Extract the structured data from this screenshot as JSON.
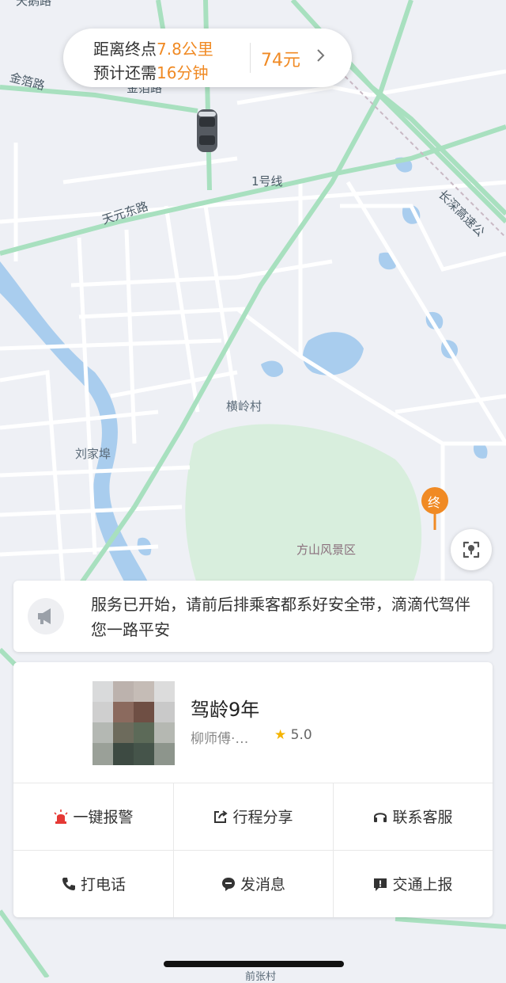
{
  "trip": {
    "distance_prefix": "距离终点",
    "distance_value": "7.8公里",
    "time_prefix": "预计还需",
    "time_value": "16分钟",
    "price": "74元"
  },
  "map": {
    "labels": {
      "top_left": "天鹅路",
      "jinju_road": "金箔路",
      "jinju_road_2": "金箔路",
      "line1": "1号线",
      "tianyuan_road": "天元东路",
      "changshen": "长深高速公",
      "henglingcun": "横岭村",
      "liujiahan": "刘家埠",
      "fangshan": "方山风景区",
      "bottom": "前张村"
    },
    "end_marker": "终"
  },
  "notice": {
    "text": "服务已开始，请前后排乘客都系好安全带，滴滴代驾伴您一路平安"
  },
  "driver": {
    "experience": "驾龄9年",
    "name": "柳师傅·…",
    "rating": "5.0"
  },
  "actions": {
    "alarm": "一键报警",
    "share": "行程分享",
    "service": "联系客服",
    "call": "打电话",
    "message": "发消息",
    "report": "交通上报"
  },
  "colors": {
    "accent": "#f08a24",
    "alarm": "#e53935",
    "road_green": "#a8e0bf",
    "water": "#9ec9ee",
    "park": "#d6eddc"
  }
}
